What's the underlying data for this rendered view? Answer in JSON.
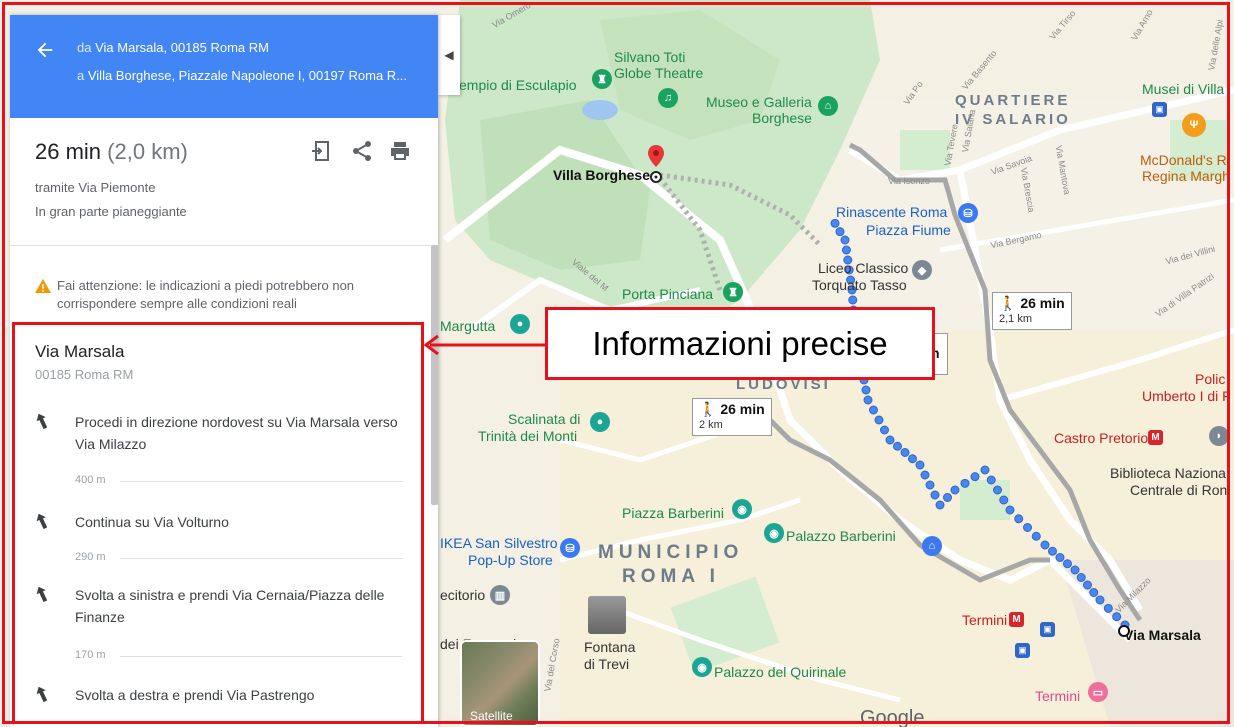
{
  "header": {
    "from_prefix": "da",
    "from_place": "Via Marsala, 00185 Roma RM",
    "to_prefix": "a",
    "to_place": "Villa Borghese, Piazzale Napoleone I, 00197 Roma R..."
  },
  "summary": {
    "time": "26 min",
    "distance": "(2,0 km)",
    "via": "tramite Via Piemonte",
    "terrain": "In gran parte pianeggiante"
  },
  "warning": "Fai attenzione: le indicazioni a piedi potrebbero non corrispondere sempre alle condizioni reali",
  "directions": {
    "start_title": "Via Marsala",
    "start_subtitle": "00185 Roma RM",
    "steps": [
      {
        "text": "Procedi in direzione nordovest su Via Marsala verso Via Milazzo",
        "distance": "400 m"
      },
      {
        "text": "Continua su Via Volturno",
        "distance": "290 m"
      },
      {
        "text": "Svolta a sinistra e prendi Via Cernaia/Piazza delle Finanze",
        "distance": "170 m"
      },
      {
        "text": "Svolta a destra e prendi Via Pastrengo",
        "distance": ""
      }
    ]
  },
  "callout": "Informazioni precise",
  "map": {
    "labels": {
      "silvano": "Silvano Toti",
      "globe": "Globe Theatre",
      "tempio": "Tempio di Esculapio",
      "museo1": "Museo e Galleria",
      "museo2": "Borghese",
      "villa_borghese": "Villa Borghese",
      "quartiere1": "QUARTIERE",
      "quartiere2": "IV SALARIO",
      "musei_villa": "Musei di Villa",
      "mcdonalds1": "McDonald's R",
      "mcdonalds2": "Regina Margh",
      "rinascente1": "Rinascente Roma",
      "rinascente2": "Piazza Fiume",
      "liceo1": "Liceo Classico",
      "liceo2": "Torquato Tasso",
      "porta": "Porta Pinciana",
      "margutta": "Margutta",
      "ludovisi": "LUDOVISI",
      "scalinata1": "Scalinata di",
      "scalinata2": "Trinità dei Monti",
      "castro": "Castro Pretorio",
      "policlinico1": "Polic",
      "policlinico2": "Umberto I di F",
      "biblioteca1": "Biblioteca Naziona",
      "biblioteca2": "Centrale di Ron",
      "barberini": "Piazza Barberini",
      "palazzo_barberini": "Palazzo Barberini",
      "ikea1": "IKEA San Silvestro",
      "ikea2": "Pop-Up Store",
      "municipio1": "MUNICIPIO",
      "municipio2": "ROMA I",
      "citorio": "ecitorio",
      "fontana1": "Fontana",
      "fontana2": "di Trevi",
      "francesi": "dei Francesi",
      "quirinale": "Palazzo del Quirinale",
      "termini_metro": "Termini",
      "termini": "Termini",
      "via_marsala": "Via Marsala",
      "satellite": "Satellite",
      "google": "Google",
      "street_veneto": "Viale del M",
      "street_salaria": "Via Salaria",
      "street_po": "Via Po",
      "street_tevere": "Via Tevere",
      "street_savoia": "Via Savoia",
      "street_mantova": "Via Mantova",
      "street_brescia": "Via Brescia",
      "street_bergamo": "Via Bergamo",
      "street_villini": "Via dei Villini",
      "street_patrizi": "Via di Villa Patrizi",
      "street_isonzo": "Via Isonzo",
      "street_milazzo": "Via Milazzo",
      "street_corso": "Via del Corso",
      "street_omero": "Via Omero",
      "street_basento": "Via Basento",
      "street_tirso": "Via Tirso",
      "street_arno": "Via Arno",
      "street_delle_alpi": "Via delle Alpi"
    },
    "walk_boxes": [
      {
        "time": "26 min",
        "dist": "2,1 km"
      },
      {
        "time": "26 min",
        "dist": "2 km"
      }
    ],
    "partial_box": "n"
  }
}
